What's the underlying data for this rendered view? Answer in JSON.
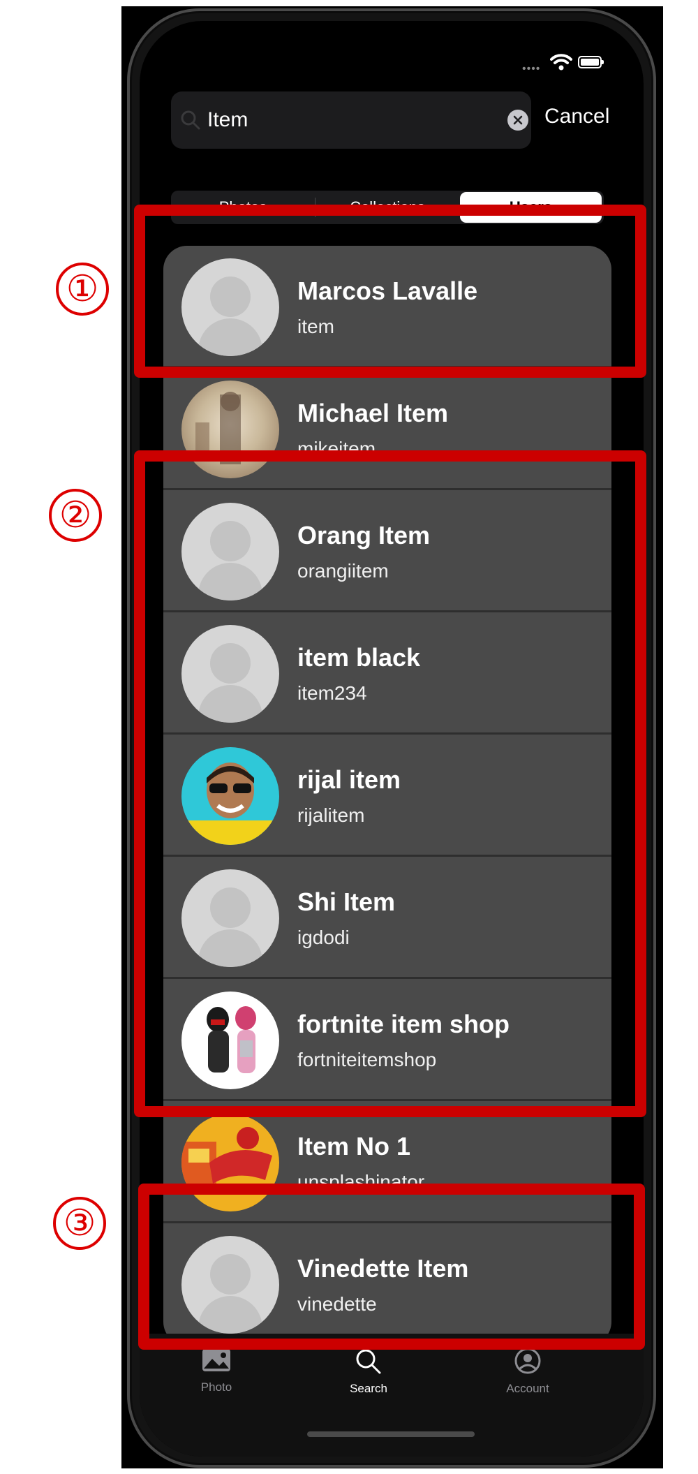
{
  "search": {
    "value": "Item"
  },
  "cancel_label": "Cancel",
  "segments": [
    {
      "label": "Photos",
      "active": false
    },
    {
      "label": "Collections",
      "active": false
    },
    {
      "label": "Users",
      "active": true
    }
  ],
  "users": [
    {
      "name": "Marcos Lavalle",
      "username": "item",
      "avatar": "default-avatar-icon"
    },
    {
      "name": "Michael Item",
      "username": "mikeitem",
      "avatar": "photo"
    },
    {
      "name": "Orang Item",
      "username": "orangiitem",
      "avatar": "default-avatar-icon"
    },
    {
      "name": "item black",
      "username": "item234",
      "avatar": "default-avatar-icon"
    },
    {
      "name": "rijal item",
      "username": "rijalitem",
      "avatar": "photo"
    },
    {
      "name": "Shi Item",
      "username": "igdodi",
      "avatar": "default-avatar-icon"
    },
    {
      "name": "fortnite item shop",
      "username": "fortniteitemshop",
      "avatar": "photo"
    },
    {
      "name": "Item No 1",
      "username": "unsplashinator",
      "avatar": "photo"
    },
    {
      "name": "Vinedette Item",
      "username": "vinedette",
      "avatar": "default-avatar-icon"
    }
  ],
  "tabs": [
    {
      "label": "Photo",
      "icon": "photo-icon",
      "active": false
    },
    {
      "label": "Search",
      "icon": "search-icon",
      "active": true
    },
    {
      "label": "Account",
      "icon": "account-icon",
      "active": false
    }
  ],
  "annotations": [
    "①",
    "②",
    "③"
  ],
  "colors": {
    "annotation_red": "#cc0000",
    "row_background": "#4a4a4a",
    "screen_background": "#000000"
  }
}
